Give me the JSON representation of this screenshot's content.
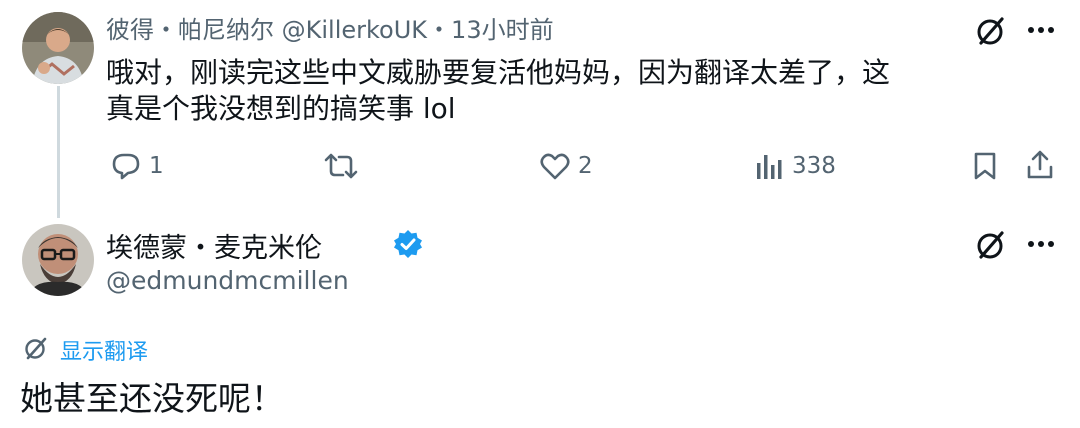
{
  "reply_tweet": {
    "display_name": "彼得・帕尼纳尔",
    "handle": "@KillerkoUK",
    "separator": "・",
    "time": "13小时前",
    "text_line1": "哦对，刚读完这些中文威胁要复活他妈妈，因为翻译太差了，这",
    "text_line2": "真是个我没想到的搞笑事 lol",
    "actions": {
      "reply_count": "1",
      "retweet_count": "",
      "like_count": "2",
      "views_count": "338"
    }
  },
  "main_tweet": {
    "display_name": "埃德蒙・麦克米伦",
    "handle": "@edmundmcmillen",
    "verified": true,
    "translate_label": "显示翻译",
    "text": "她甚至还没死呢！"
  },
  "colors": {
    "accent": "#1d9bf0",
    "text_primary": "#0f1419",
    "text_secondary": "#536471",
    "thread_line": "#cfd9de"
  }
}
